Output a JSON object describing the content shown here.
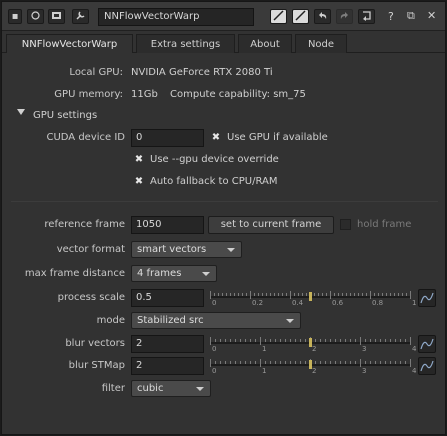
{
  "window": {
    "node_name": "NNFlowVectorWarp",
    "title_icons": [
      "circle-icon",
      "properties-icon",
      "wrench-icon"
    ],
    "right_icons": [
      "color-swatch-icon",
      "color-swatch-icon-2",
      "undo-icon",
      "redo-icon",
      "revert-icon"
    ],
    "window_controls": [
      "?",
      "⧉",
      "✕"
    ]
  },
  "tabs": [
    {
      "label": "NNFlowVectorWarp",
      "active": true
    },
    {
      "label": "Extra settings",
      "active": false
    },
    {
      "label": "About",
      "active": false
    },
    {
      "label": "Node",
      "active": false
    }
  ],
  "info": {
    "gpu_label": "Local GPU:",
    "gpu_value": "NVIDIA GeForce RTX 2080 Ti",
    "mem_label": "GPU memory:",
    "mem_value": "11Gb",
    "compute_value": "Compute capability: sm_75"
  },
  "gpu_settings": {
    "header": "GPU settings",
    "cuda_label": "CUDA device ID",
    "cuda_value": "0",
    "use_gpu_label": "Use GPU if available",
    "use_gpu_checked": true,
    "override_label": "Use --gpu device override",
    "override_checked": true,
    "fallback_label": "Auto fallback to CPU/RAM",
    "fallback_checked": true
  },
  "params": {
    "ref_frame_label": "reference frame",
    "ref_frame_value": "1050",
    "set_frame_button": "set to current frame",
    "hold_frame_label": "hold frame",
    "hold_frame_checked": false,
    "vector_format_label": "vector format",
    "vector_format_value": "smart vectors",
    "max_frame_label": "max frame distance",
    "max_frame_value": "4 frames",
    "process_scale_label": "process scale",
    "process_scale_value": "0.5",
    "process_scale_ticks": [
      "0",
      "0.2",
      "0.4",
      "0.6",
      "0.8",
      "1"
    ],
    "process_scale_fraction": 0.5,
    "mode_label": "mode",
    "mode_value": "Stabilized src",
    "blur_vectors_label": "blur vectors",
    "blur_vectors_value": "2",
    "blur_vectors_ticks": [
      "0",
      "1",
      "2",
      "3",
      "4"
    ],
    "blur_vectors_fraction": 0.5,
    "blur_stmap_label": "blur STMap",
    "blur_stmap_value": "2",
    "blur_stmap_ticks": [
      "0",
      "1",
      "2",
      "3",
      "4"
    ],
    "blur_stmap_fraction": 0.5,
    "filter_label": "filter",
    "filter_value": "cubic"
  },
  "colors": {
    "panel_bg": "#323232",
    "slider_handle": "#c7b35a",
    "dropdown_bg": "#4a4a4a"
  }
}
